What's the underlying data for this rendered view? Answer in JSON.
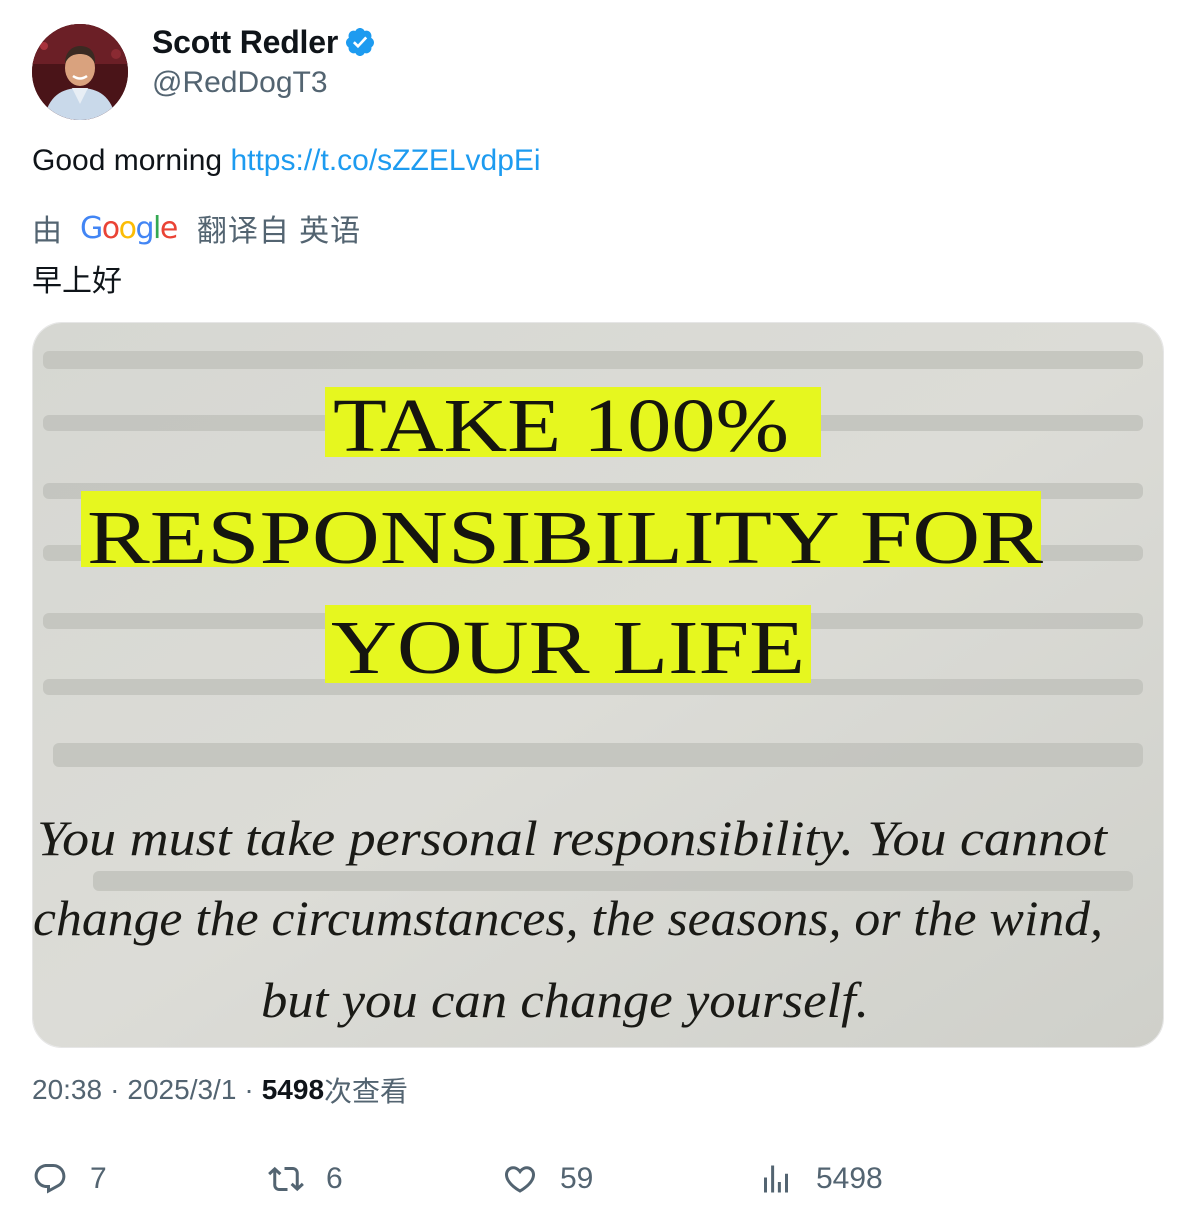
{
  "author": {
    "display_name": "Scott Redler",
    "handle": "@RedDogT3",
    "verified_icon": "verified-badge-icon",
    "verified_color": "#1d9bf0"
  },
  "tweet": {
    "text": "Good morning",
    "link": "https://t.co/sZZELvdpEi",
    "link_color": "#1d9bf0"
  },
  "translation": {
    "by_label": "由",
    "provider": "Google",
    "from_label": "翻译自 英语",
    "translated_text": "早上好"
  },
  "media": {
    "title_lines": [
      "TAKE 100%",
      "RESPONSIBILITY FOR",
      "YOUR LIFE"
    ],
    "body_lines": [
      "You must take personal responsibility. You cannot",
      "change the circumstances, the seasons, or the wind,",
      "but you can change yourself."
    ],
    "highlight_color": "#e6f71f"
  },
  "meta": {
    "time": "20:38",
    "date": "2025/3/1",
    "separator": "·",
    "views_count": "5498",
    "views_label": "次查看"
  },
  "actions": {
    "reply": {
      "icon": "reply-icon",
      "count": "7"
    },
    "retweet": {
      "icon": "retweet-icon",
      "count": "6"
    },
    "like": {
      "icon": "heart-icon",
      "count": "59"
    },
    "views": {
      "icon": "analytics-icon",
      "count": "5498"
    }
  }
}
